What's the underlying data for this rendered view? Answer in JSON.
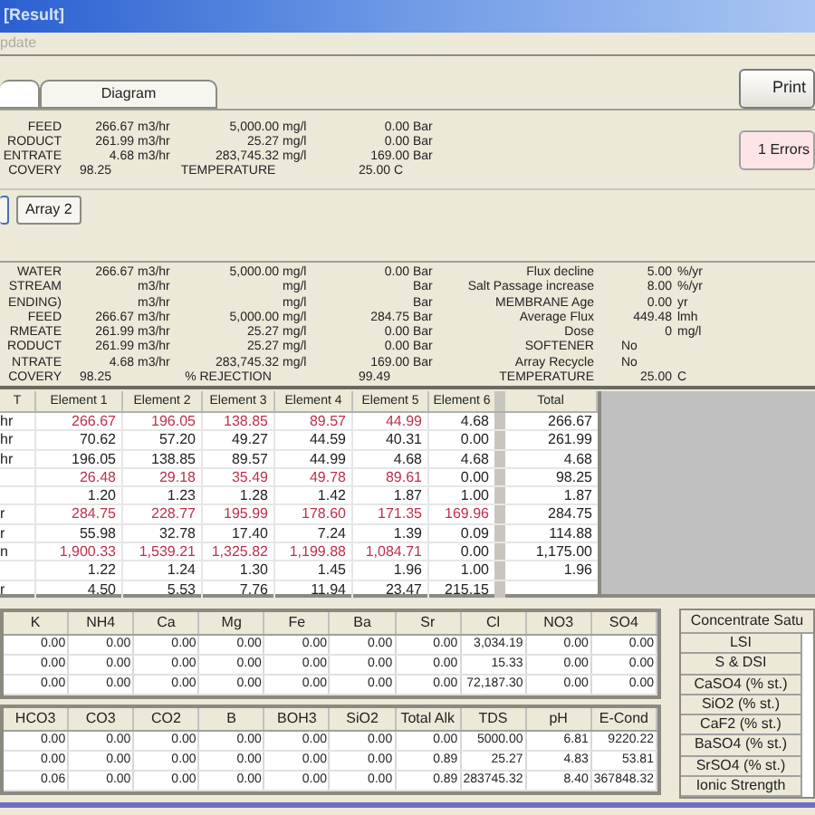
{
  "window": {
    "title": "[Result]"
  },
  "menu": [
    {
      "label": "pdate",
      "disabled": true
    }
  ],
  "tabs": [
    {
      "selected": true
    },
    {
      "label": "Diagram",
      "selected": false
    }
  ],
  "print_button": "Print",
  "errors_button": "1 Errors",
  "summary": [
    {
      "kind": "stream",
      "label": "FEED",
      "flow": "266.67",
      "flow_unit": "m3/hr",
      "conc": "5,000.00",
      "conc_unit": "mg/l",
      "pressure": "0.00",
      "pressure_unit": "Bar"
    },
    {
      "kind": "stream",
      "label": "RODUCT",
      "flow": "261.99",
      "flow_unit": "m3/hr",
      "conc": "25.27",
      "conc_unit": "mg/l",
      "pressure": "0.00",
      "pressure_unit": "Bar"
    },
    {
      "kind": "stream",
      "label": "ENTRATE",
      "flow": "4.68",
      "flow_unit": "m3/hr",
      "conc": "283,745.32",
      "conc_unit": "mg/l",
      "pressure": "169.00",
      "pressure_unit": "Bar"
    },
    {
      "kind": "recovery",
      "label": "COVERY",
      "value": "98.25",
      "second_label": "TEMPERATURE",
      "second_value": "25.00 C"
    }
  ],
  "arrays": [
    {
      "selected": true
    },
    {
      "label": "Array 2",
      "selected": false
    }
  ],
  "details": [
    {
      "kind": "stream",
      "label": "WATER",
      "flow": "266.67",
      "flow_unit": "m3/hr",
      "conc": "5,000.00",
      "conc_unit": "mg/l",
      "pressure": "0.00",
      "pressure_unit": "Bar"
    },
    {
      "kind": "stream",
      "label": "STREAM",
      "flow_unit": "m3/hr",
      "conc_unit": "mg/l",
      "pressure_unit": "Bar"
    },
    {
      "kind": "stream",
      "label": "ENDING)",
      "flow_unit": "m3/hr",
      "conc_unit": "mg/l",
      "pressure_unit": "Bar"
    },
    {
      "kind": "stream",
      "label": "FEED",
      "flow": "266.67",
      "flow_unit": "m3/hr",
      "conc": "5,000.00",
      "conc_unit": "mg/l",
      "pressure": "284.75",
      "pressure_unit": "Bar"
    },
    {
      "kind": "stream",
      "label": "RMEATE",
      "flow": "261.99",
      "flow_unit": "m3/hr",
      "conc": "25.27",
      "conc_unit": "mg/l",
      "pressure": "0.00",
      "pressure_unit": "Bar"
    },
    {
      "kind": "stream",
      "label": "RODUCT",
      "flow": "261.99",
      "flow_unit": "m3/hr",
      "conc": "25.27",
      "conc_unit": "mg/l",
      "pressure": "0.00",
      "pressure_unit": "Bar"
    },
    {
      "kind": "stream",
      "label": "NTRATE",
      "flow": "4.68",
      "flow_unit": "m3/hr",
      "conc": "283,745.32",
      "conc_unit": "mg/l",
      "pressure": "169.00",
      "pressure_unit": "Bar"
    },
    {
      "kind": "recovery",
      "label": "COVERY",
      "value": "98.25",
      "second_label": "% REJECTION",
      "second_value": "99.49"
    }
  ],
  "parameters": [
    {
      "label": "Flux decline",
      "value": "5.00",
      "unit": "%/yr"
    },
    {
      "label": "Salt Passage increase",
      "value": "8.00",
      "unit": "%/yr"
    },
    {
      "label": "MEMBRANE Age",
      "value": "0.00",
      "unit": "yr"
    },
    {
      "label": "Average Flux",
      "value": "449.48",
      "unit": "lmh"
    },
    {
      "label": "Dose",
      "value": "0",
      "unit": "mg/l"
    },
    {
      "label": "SOFTENER",
      "value": "No"
    },
    {
      "label": "Array Recycle",
      "value": "No"
    },
    {
      "label": "TEMPERATURE",
      "value": "25.00",
      "unit": "C"
    }
  ],
  "elements": {
    "columns": [
      "T",
      "Element 1",
      "Element 2",
      "Element 3",
      "Element 4",
      "Element 5",
      "Element 6",
      "Total"
    ],
    "rows": [
      {
        "cells": [
          "hr",
          "266.67",
          "196.05",
          "138.85",
          "89.57",
          "44.99",
          "4.68",
          "266.67"
        ],
        "flagged": [
          true,
          true,
          true,
          true,
          true,
          false
        ]
      },
      {
        "cells": [
          "hr",
          "70.62",
          "57.20",
          "49.27",
          "44.59",
          "40.31",
          "0.00",
          "261.99"
        ],
        "flagged": [
          false,
          false,
          false,
          false,
          false,
          false
        ]
      },
      {
        "cells": [
          "hr",
          "196.05",
          "138.85",
          "89.57",
          "44.99",
          "4.68",
          "4.68",
          "4.68"
        ],
        "flagged": [
          false,
          false,
          false,
          false,
          false,
          false
        ]
      },
      {
        "cells": [
          "",
          "26.48",
          "29.18",
          "35.49",
          "49.78",
          "89.61",
          "0.00",
          "98.25"
        ],
        "flagged": [
          true,
          true,
          true,
          true,
          true,
          false
        ]
      },
      {
        "cells": [
          "",
          "1.20",
          "1.23",
          "1.28",
          "1.42",
          "1.87",
          "1.00",
          "1.87"
        ],
        "flagged": [
          false,
          false,
          false,
          false,
          false,
          false
        ]
      },
      {
        "cells": [
          "r",
          "284.75",
          "228.77",
          "195.99",
          "178.60",
          "171.35",
          "169.96",
          "284.75"
        ],
        "flagged": [
          true,
          true,
          true,
          true,
          true,
          true
        ]
      },
      {
        "cells": [
          "r",
          "55.98",
          "32.78",
          "17.40",
          "7.24",
          "1.39",
          "0.09",
          "114.88"
        ],
        "flagged": [
          false,
          false,
          false,
          false,
          false,
          false
        ]
      },
      {
        "cells": [
          "n",
          "1,900.33",
          "1,539.21",
          "1,325.82",
          "1,199.88",
          "1,084.71",
          "0.00",
          "1,175.00"
        ],
        "flagged": [
          true,
          true,
          true,
          true,
          true,
          false
        ]
      },
      {
        "cells": [
          "",
          "1.22",
          "1.24",
          "1.30",
          "1.45",
          "1.96",
          "1.00",
          "1.96"
        ],
        "flagged": [
          false,
          false,
          false,
          false,
          false,
          false
        ]
      },
      {
        "cells": [
          "r",
          "4.50",
          "5.53",
          "7.76",
          "11.94",
          "23.47",
          "215.15",
          ""
        ],
        "flagged": [
          false,
          false,
          false,
          false,
          false,
          false
        ]
      }
    ]
  },
  "ions_1": {
    "columns": [
      "K",
      "NH4",
      "Ca",
      "Mg",
      "Fe",
      "Ba",
      "Sr",
      "Cl",
      "NO3",
      "SO4"
    ],
    "rows": [
      [
        "0.00",
        "0.00",
        "0.00",
        "0.00",
        "0.00",
        "0.00",
        "0.00",
        "3,034.19",
        "0.00",
        "0.00"
      ],
      [
        "0.00",
        "0.00",
        "0.00",
        "0.00",
        "0.00",
        "0.00",
        "0.00",
        "15.33",
        "0.00",
        "0.00"
      ],
      [
        "0.00",
        "0.00",
        "0.00",
        "0.00",
        "0.00",
        "0.00",
        "0.00",
        "72,187.30",
        "0.00",
        "0.00"
      ]
    ]
  },
  "ions_2": {
    "columns": [
      "HCO3",
      "CO3",
      "CO2",
      "B",
      "BOH3",
      "SiO2",
      "Total Alk",
      "TDS",
      "pH",
      "E-Cond"
    ],
    "rows": [
      [
        "0.00",
        "0.00",
        "0.00",
        "0.00",
        "0.00",
        "0.00",
        "0.00",
        "5000.00",
        "6.81",
        "9220.22"
      ],
      [
        "0.00",
        "0.00",
        "0.00",
        "0.00",
        "0.00",
        "0.00",
        "0.89",
        "25.27",
        "4.83",
        "53.81"
      ],
      [
        "0.06",
        "0.00",
        "0.00",
        "0.00",
        "0.00",
        "0.00",
        "0.89",
        "283745.32",
        "8.40",
        "367848.32"
      ]
    ]
  },
  "saturation": {
    "title": "Concentrate Satu",
    "rows": [
      "LSI",
      "S & DSI",
      "CaSO4 (% st.)",
      "SiO2 (% st.)",
      "CaF2 (% st.)",
      "BaSO4 (% st.)",
      "SrSO4 (% st.)",
      "Ionic Strength"
    ]
  }
}
